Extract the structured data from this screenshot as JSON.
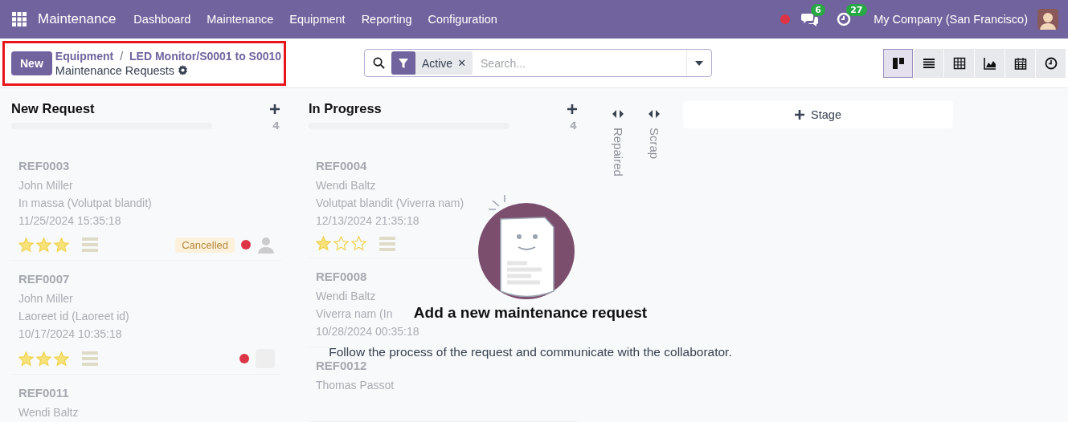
{
  "navbar": {
    "app_name": "Maintenance",
    "menu": [
      "Dashboard",
      "Maintenance",
      "Equipment",
      "Reporting",
      "Configuration"
    ],
    "status_dot": {
      "color": "#dc3545"
    },
    "messages_count": "6",
    "activities_count": "27",
    "company": "My Company (San Francisco)"
  },
  "control_panel": {
    "new_button": "New",
    "breadcrumbs": [
      "Equipment",
      "LED Monitor/S0001 to S0010"
    ],
    "breadcrumb_separator": "/",
    "title": "Maintenance Requests",
    "highlighted": true,
    "search": {
      "facet": "Active",
      "remove_facet": "✕",
      "placeholder": "Search..."
    },
    "views": [
      {
        "kind": "kanban",
        "selected": true
      },
      {
        "kind": "list",
        "selected": false
      },
      {
        "kind": "pivot",
        "selected": false
      },
      {
        "kind": "graph",
        "selected": false
      },
      {
        "kind": "calendar",
        "selected": false
      },
      {
        "kind": "activity",
        "selected": false
      }
    ]
  },
  "columns": [
    {
      "title": "New Request",
      "count": "4",
      "cards": [
        {
          "ref": "REF0003",
          "name": "John Miller",
          "equipment": "In massa (Volutpat blandit)",
          "date": "11/25/2024 15:35:18",
          "stars": 3,
          "badge": "Cancelled",
          "color": "#dc3545",
          "avatar": true
        },
        {
          "ref": "REF0007",
          "name": "John Miller",
          "equipment": "Laoreet id (Laoreet id)",
          "date": "10/17/2024 10:35:18",
          "stars": 3,
          "color": "#dc3545",
          "avatar": true,
          "avatar_is_photo": true
        },
        {
          "ref": "REF0011",
          "name": "Wendi Baltz"
        }
      ]
    },
    {
      "title": "In Progress",
      "count": "4",
      "cards": [
        {
          "ref": "REF0004",
          "name": "Wendi Baltz",
          "equipment": "Volutpat blandit (Viverra nam)",
          "date": "12/13/2024 21:35:18",
          "stars": 1
        },
        {
          "ref": "REF0008",
          "name": "Wendi Baltz",
          "equipment": "Viverra nam (In",
          "date": "10/28/2024 00:35:18"
        },
        {
          "ref": "REF0012",
          "name": "Thomas Passot"
        }
      ]
    }
  ],
  "folded_columns": [
    {
      "title": "Repaired"
    },
    {
      "title": "Scrap"
    }
  ],
  "add_stage": "Stage",
  "help": {
    "title": "Add a new maintenance request",
    "text": "Follow the process of the request and communicate with the collaborator."
  }
}
